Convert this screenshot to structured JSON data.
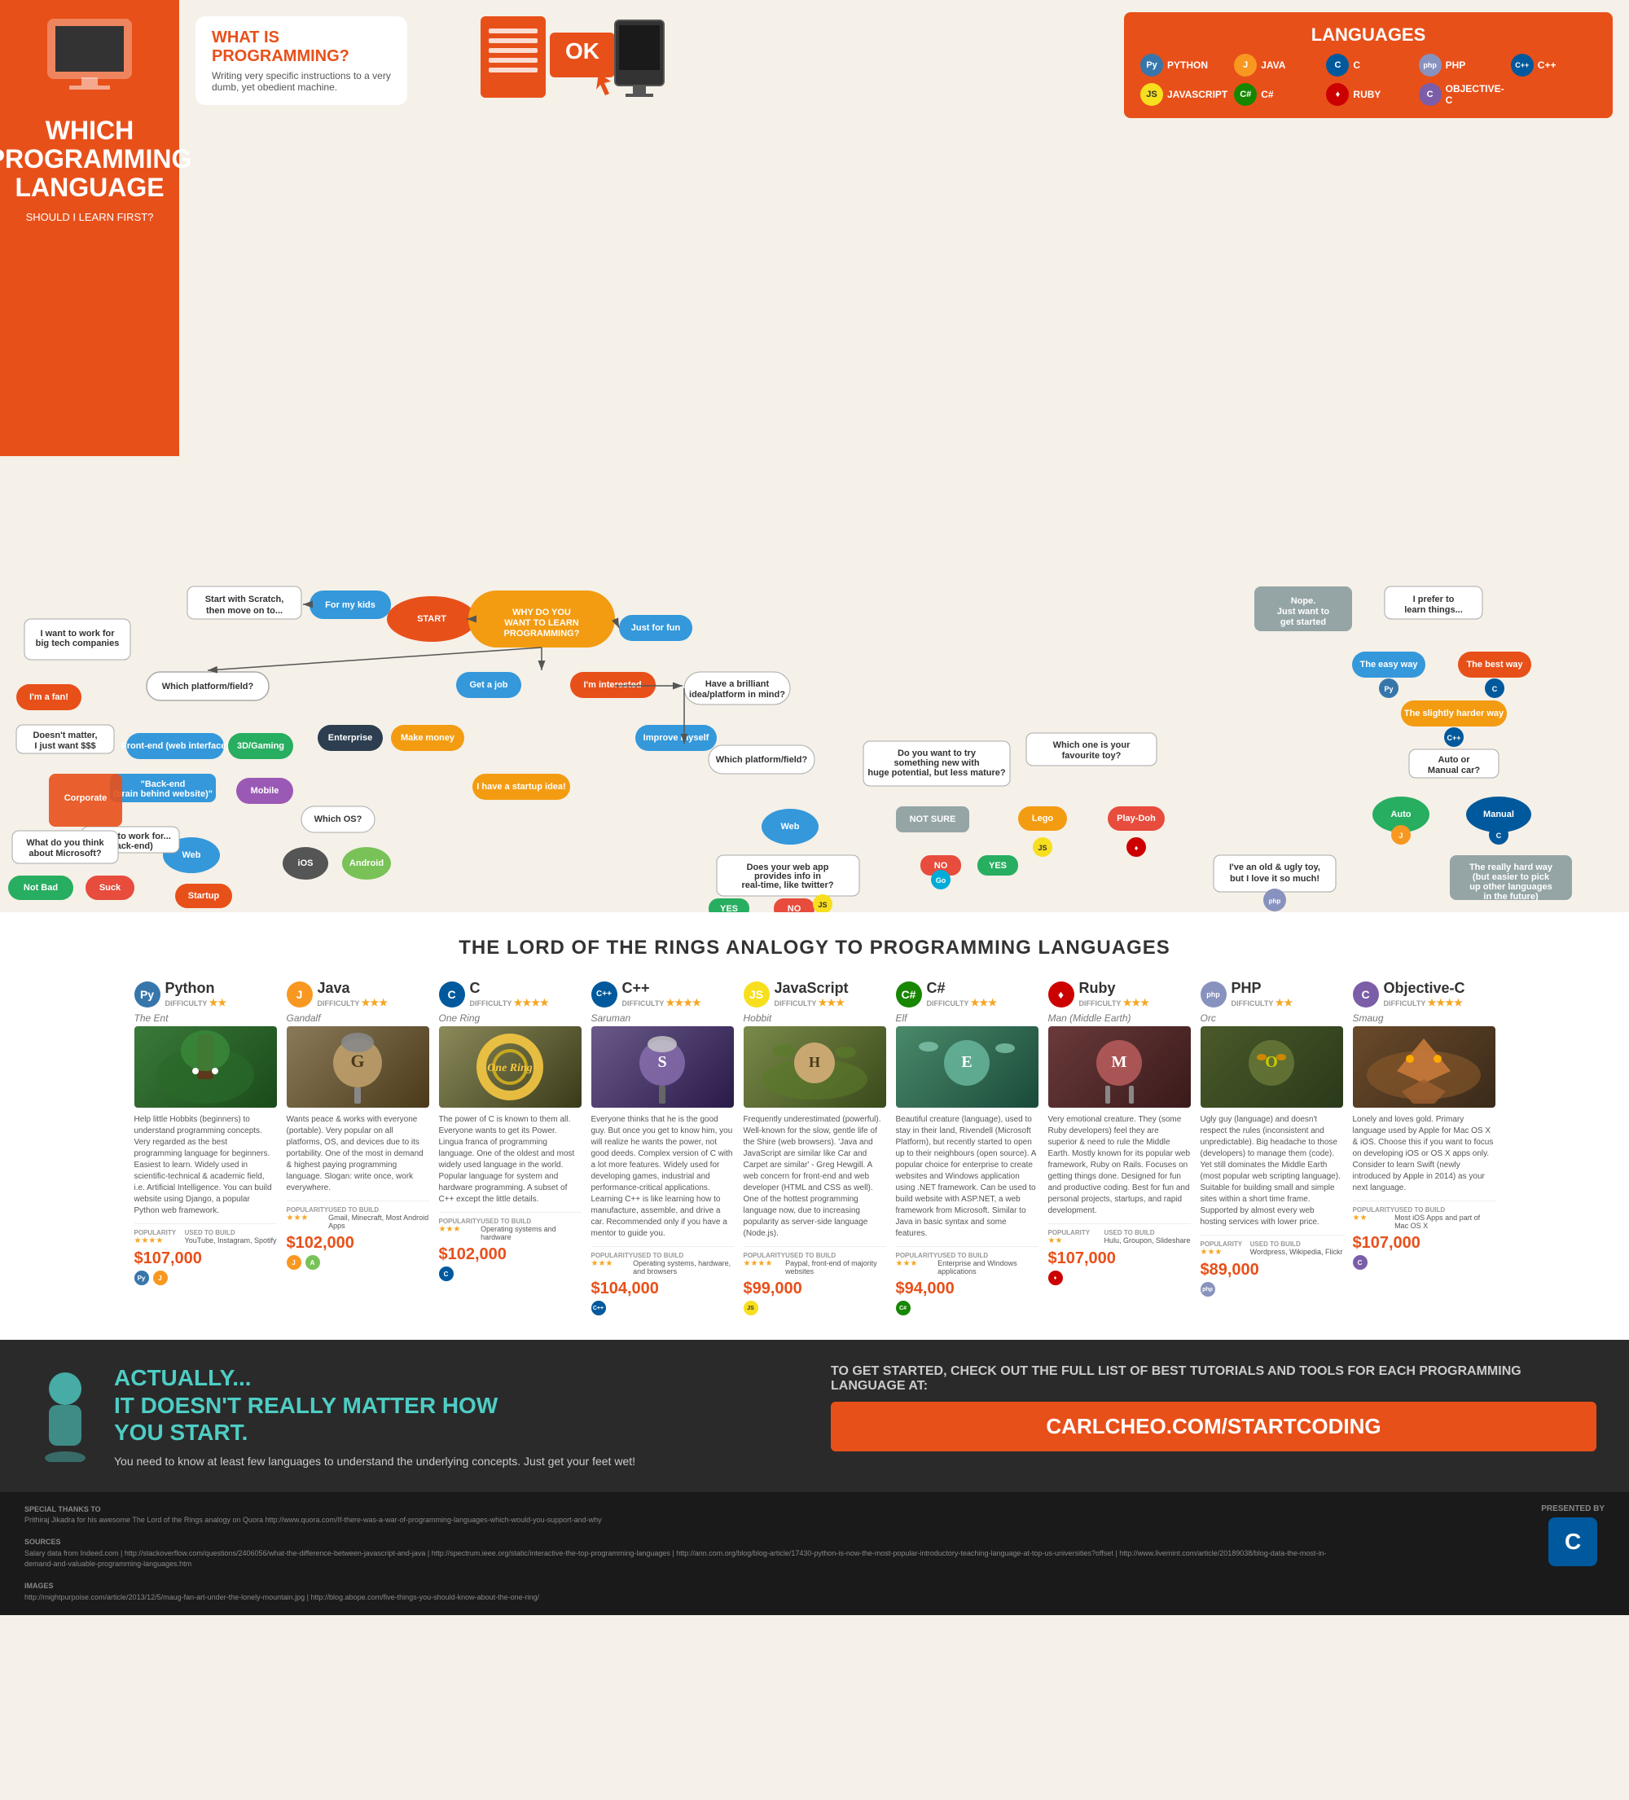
{
  "header": {
    "left_panel": {
      "title": "WHICH\nPROGRAMMING\nLANGUAGE",
      "subtitle": "SHOULD I LEARN FIRST?"
    },
    "what_is_programming": {
      "title": "WHAT IS PROGRAMMING?",
      "description": "Writing very specific instructions to a very dumb, yet obedient machine."
    },
    "ok_text": "OK",
    "languages": {
      "title": "LANGUAGES",
      "items": [
        {
          "name": "PYTHON",
          "logo": "Py",
          "class": "lang-python"
        },
        {
          "name": "JAVA",
          "logo": "J",
          "class": "lang-java"
        },
        {
          "name": "C",
          "logo": "C",
          "class": "lang-c"
        },
        {
          "name": "PHP",
          "logo": "php",
          "class": "lang-php"
        },
        {
          "name": "C++",
          "logo": "C++",
          "class": "lang-cpp"
        },
        {
          "name": "JAVASCRIPT",
          "logo": "JS",
          "class": "lang-js"
        },
        {
          "name": "C#",
          "logo": "C#",
          "class": "lang-csharp"
        },
        {
          "name": "RUBY",
          "logo": "♦",
          "class": "lang-ruby"
        },
        {
          "name": "OBJECTIVE-C",
          "logo": "C",
          "class": "lang-objc"
        }
      ]
    }
  },
  "flowchart": {
    "title": "WHICH PROGRAMMING LANGUAGE SHOULD I LEARN FIRST?",
    "nodes": {
      "start": "START",
      "why_learn": "WHY DO YOU WANT TO LEARN PROGRAMMING?",
      "for_kids": "For my kids",
      "scratch": "Start with Scratch, then move on to...",
      "get_job": "Get a job",
      "make_money": "Make money",
      "startup": "I have a startup idea!",
      "which_platform": "Which platform/field?",
      "frontend": "Front-end (web interface)",
      "backend": "Back-end (\"brain\" behind a website)",
      "threed_gaming": "3D/Gaming",
      "mobile": "Mobile",
      "web_node": "Web",
      "corporate": "Corporate",
      "doesnt_matter": "Doesn't matter, I just want $$$",
      "im_a_fan": "I'm a fan!",
      "which_os": "Which OS?",
      "ios": "iOS",
      "android": "Android",
      "enterprise": "Enterprise",
      "startup_node": "Startup",
      "i_want_work": "I want to work for...",
      "what_think_ms": "What do you think about Microsoft?",
      "not_bad": "Not Bad",
      "suck": "Suck",
      "i_want_big_tech": "I want to work for big tech companies",
      "just_for_fun": "Just for fun",
      "im_interested": "I'm interested",
      "improve_myself": "Improve myself",
      "brilliant_idea": "Have a brilliant idea/platform in mind?",
      "which_platform2": "Which platform/field?",
      "web2": "Web",
      "does_web_app": "Does your web app provides info in real-time, like twitter?",
      "yes_ans": "YES",
      "no_ans": "NO",
      "not_sure": "NOT SURE",
      "no2": "NO",
      "yes2": "YES",
      "try_something": "Do you want to try something new with huge potential, but less mature?",
      "which_toy": "Which one is your favourite toy?",
      "lego": "Lego",
      "playdoh": "Play-Doh",
      "nope": "Nope. Just want to get started",
      "i_prefer": "I prefer to learn things...",
      "easy_way": "The easy way",
      "best_way": "The best way",
      "slightly_harder": "The slightly harder way",
      "auto_or_manual": "Auto or Manual car?",
      "auto": "Auto",
      "manual": "Manual",
      "really_hard_way": "The really hard way (but easier to pick up other languages in the future)",
      "old_ugly": "I've an old & ugly toy, but I love it so much!"
    }
  },
  "lotr": {
    "title": "THE LORD OF THE RINGS ANALOGY TO PROGRAMMING LANGUAGES",
    "cards": [
      {
        "lang": "Python",
        "char": "The Ent",
        "difficulty": "★★",
        "logo": "Py",
        "logo_class": "lang-python",
        "color": "#3776ab",
        "desc": "Help little Hobbits (beginners) to understand programming concepts. Very regarded as the best programming language for beginners. Easiest to learn. Widely used in scientific-technical & academic field, i.e. Artificial Intelligence. You can build website using Django, a popular Python web framework.",
        "popularity": "★★★★",
        "used_to_build": "YouTube, Instagram, Spotify",
        "avg_salary": "$107,000"
      },
      {
        "lang": "Java",
        "char": "Gandalf",
        "difficulty": "★★★",
        "logo": "J",
        "logo_class": "lang-java",
        "color": "#f89820",
        "desc": "Wants peace & works with everyone (portable). Very popular on all platforms, OS, and devices due to its portability. One of the most in demand & highest paying programming language. Slogan: write once, work everywhere.",
        "popularity": "★★★",
        "used_to_build": "Gmail, Minecraft, Most Android Apps, Enterprise applications",
        "avg_salary": "$102,000"
      },
      {
        "lang": "C",
        "char": "One Ring",
        "difficulty": "★★★★",
        "logo": "C",
        "logo_class": "lang-c",
        "color": "#00599c",
        "desc": "The power of C is known to them all. Everyone wants to get its Power. Lingua franca of programming language. One of the oldest and most widely used language in the world. Popular language for system and hardware programming. A subset of C++ except the little details.",
        "popularity": "★★★",
        "used_to_build": "Operating systems and hardware",
        "avg_salary": "$102,000"
      },
      {
        "lang": "C++",
        "char": "Saruman",
        "difficulty": "★★★★",
        "logo": "C++",
        "logo_class": "lang-cpp",
        "color": "#00599c",
        "desc": "Everyone thinks that he is the good guy. But once you get to know him, you will realize he wants the power, not good deeds. Complex version of C with a lot more features. Widely used for developing games, industrial and performance-critical applications. Learning C++ is like learning how to manufacture, assemble, and drive a car. Recommended only if you have a mentor to guide you.",
        "popularity": "★★★",
        "used_to_build": "Operating systems, hardware, and browsers",
        "avg_salary": "$104,000"
      },
      {
        "lang": "JavaScript",
        "char": "Hobbit",
        "difficulty": "★★★",
        "logo": "JS",
        "logo_class": "lang-js",
        "color": "#f7df1e",
        "desc": "Frequently underestimated (powerful). Well-known for the slow, gentle life of the Shire (web browsers). 'Java and JavaScript are similar like Car and Carpet are similar' - Greg Hewgill. A web concern for front-end and web developer (HTML and CSS as well). One of the hottest programming language now, due to increasing popularity as server-side language (Node.js).",
        "popularity": "★★★★",
        "used_to_build": "Paypal, front-end of majority websites",
        "avg_salary": "$99,000"
      },
      {
        "lang": "C#",
        "char": "Elf",
        "difficulty": "★★★",
        "logo": "C#",
        "logo_class": "lang-csharp",
        "color": "#178600",
        "desc": "Beautiful creature (language), used to stay in their land, Rivendell (Microsoft Platform), but recently started to open up to their neighbors (open source). A popular choice for enterprise to create websites and Windows application using .NET framework. Can be used to build website with ASP.NET, a web framework from Microsoft. Similar to Java in basic syntax and some features.",
        "popularity": "★★★",
        "used_to_build": "Enterprise and Windows applications",
        "avg_salary": "$94,000"
      },
      {
        "lang": "Ruby",
        "char": "Man (Middle Earth)",
        "difficulty": "★★★",
        "logo": "♦",
        "logo_class": "lang-ruby",
        "color": "#cc0000",
        "desc": "Very emotional creature. They (some Ruby developers) feel they are superior & need to rule the Middle Earth. Mostly known for its popular web framework, Ruby on Rails. Focuses on getting things done. Designed for fun and productive coding. Best for fun and personal projects, startups, and rapid development.",
        "popularity": "★★",
        "used_to_build": "Hulu, Groupon, Slideshare",
        "avg_salary": "$107,000"
      },
      {
        "lang": "PHP",
        "char": "Orc",
        "difficulty": "★★",
        "logo": "php",
        "logo_class": "lang-php",
        "color": "#8892be",
        "desc": "Ugly guy (language) and doesn't respect the rules (inconsistent and unpredictable). Big headache to those (developers) to manage them (code). Yet still dominates the Middle Earth (most popular web scripting language). Suitable for building small and simple sites within a short time frame. Supported by almost every web hosting services with lower price.",
        "popularity": "★★★",
        "used_to_build": "Wordpress, Wikipedia, Flickr",
        "avg_salary": "$89,000"
      },
      {
        "lang": "Objective-C",
        "char": "Smaug",
        "difficulty": "★★★★",
        "logo": "C",
        "logo_class": "lang-objc",
        "color": "#7b5ea7",
        "desc": "Lonely and loves gold. Primary language used by Apple for Mac OS X & iOS. Choose this if you want to focus on developing iOS or OS X apps only. Consider to learn Swift (newly introduced by Apple in 2014) as your next language.",
        "popularity": "★★",
        "used_to_build": "Most iOS Apps and part of Mac OS X",
        "avg_salary": "$107,000"
      }
    ]
  },
  "bottom": {
    "left": {
      "heading": "ACTUALLY...\nIT DOESN'T REALLY MATTER HOW\nYOU START.",
      "text": "You need to know at least few languages to understand the underlying concepts. Just get your feet wet!"
    },
    "right": {
      "text": "TO GET STARTED, CHECK OUT THE FULL LIST OF BEST TUTORIALS AND TOOLS FOR EACH PROGRAMMING LANGUAGE AT:",
      "url": "CARLCHEO.COM/STARTCODING"
    }
  },
  "footer": {
    "special_thanks": "SPECIAL THANKS TO",
    "sources_label": "SOURCES",
    "images_label": "IMAGES",
    "presented_by": "PRESENTED BY",
    "logo": "C"
  }
}
